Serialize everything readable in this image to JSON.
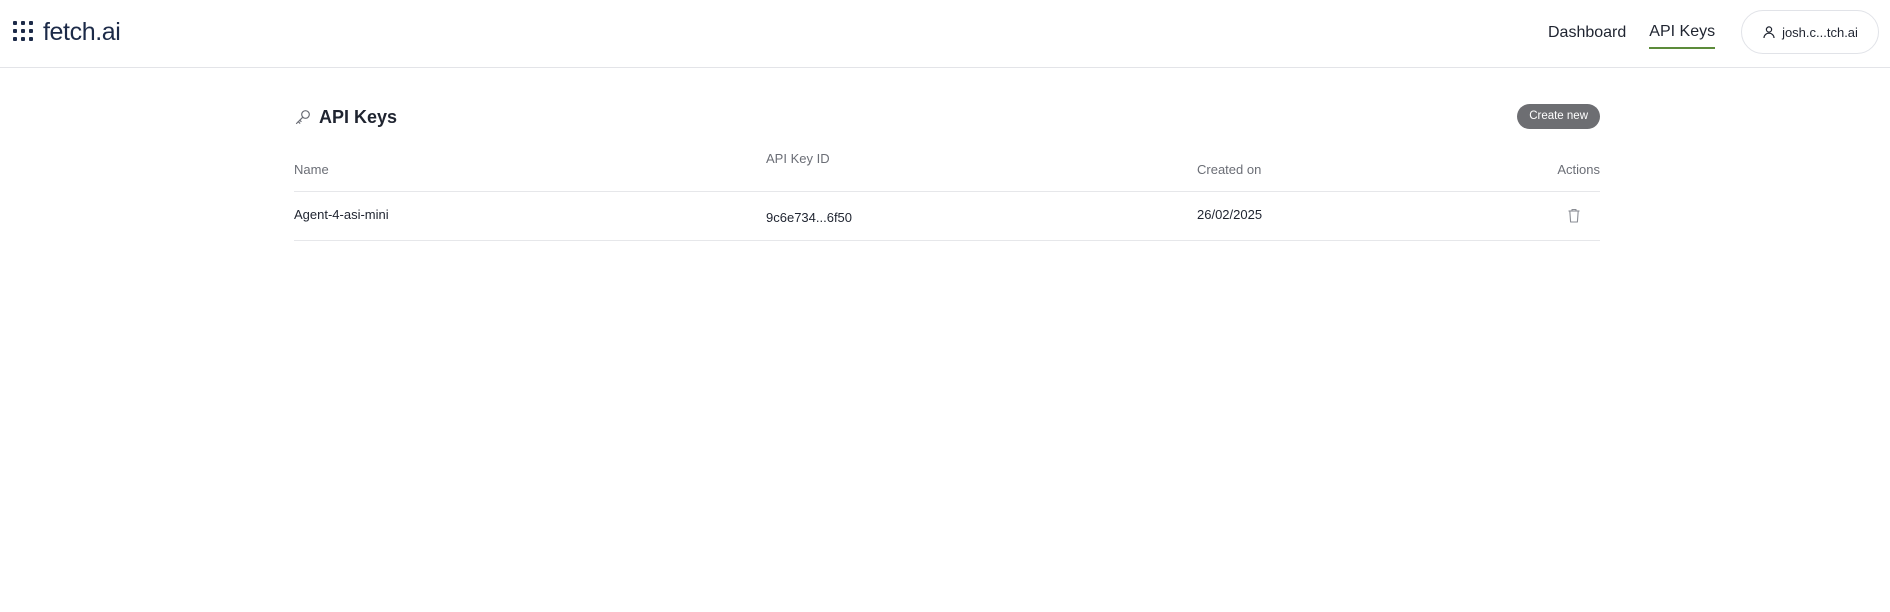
{
  "header": {
    "logo_text": "fetch.ai",
    "logo_icon": "dot-grid-icon",
    "nav": [
      {
        "label": "Dashboard",
        "active": false
      },
      {
        "label": "API Keys",
        "active": true
      }
    ],
    "user": {
      "label": "josh.c...tch.ai",
      "icon": "user-icon"
    },
    "accent_color": "#5c8b3a"
  },
  "page": {
    "title": "API Keys",
    "title_icon": "key-icon",
    "create_button_label": "Create new",
    "create_button_color": "#6d6e72"
  },
  "table": {
    "columns": {
      "name": "Name",
      "id": "API Key ID",
      "created": "Created on",
      "actions": "Actions"
    },
    "rows": [
      {
        "name": "Agent-4-asi-mini",
        "id": "9c6e734...6f50",
        "created": "26/02/2025",
        "action_icon": "trash-icon"
      }
    ]
  }
}
